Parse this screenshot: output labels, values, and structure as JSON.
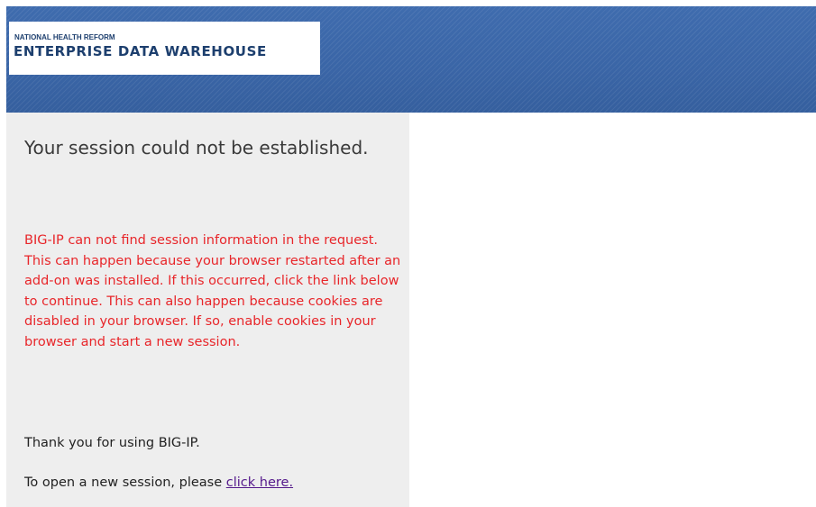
{
  "header": {
    "logo_line1": "NATIONAL HEALTH REFORM",
    "logo_line2": "ENTERPRISE DATA WAREHOUSE"
  },
  "main": {
    "title": "Your session could not be established.",
    "error_message": "BIG-IP can not find session information in the request. This can happen because your browser restarted after an add-on was installed. If this occurred, click the link below to continue. This can also happen because cookies are disabled in your browser. If so, enable cookies in your browser and start a new session.",
    "thanks_message": "Thank you for using BIG-IP.",
    "new_session_prefix": "To open a new session, please ",
    "new_session_link": "click here."
  },
  "colors": {
    "header_blue": "#3c68a8",
    "panel_gray": "#eeeeee",
    "error_red": "#e8262a",
    "link_purple": "#551a8b",
    "logo_navy": "#1d3f6e"
  }
}
